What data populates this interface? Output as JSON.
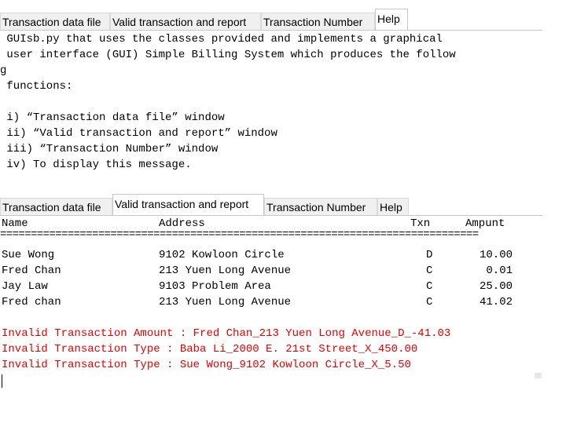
{
  "tabs": [
    "Transaction data file",
    "Valid transaction and report",
    "Transaction Number",
    "Help"
  ],
  "help": {
    "lines": [
      " GUIsb.py that uses the classes provided and implements a graphical",
      " user interface (GUI) Simple Billing System which produces the follow",
      "g",
      " functions:",
      "",
      " i) “Transaction data file” window",
      " ii) “Valid transaction and report” window",
      " iii) “Transaction Number” window",
      " iv) To display this message."
    ]
  },
  "report": {
    "header": {
      "name": "Name",
      "address": "Address",
      "txn": "Txn",
      "amount": "Ampunt"
    },
    "separator": "==============================================================================",
    "rows": [
      {
        "name": "Sue Wong",
        "address": "9102 Kowloon Circle",
        "txn": "D",
        "amount": "10.00"
      },
      {
        "name": "Fred Chan",
        "address": "213 Yuen Long Avenue",
        "txn": "C",
        "amount": "0.01"
      },
      {
        "name": "Jay Law",
        "address": "9103 Problem Area",
        "txn": "C",
        "amount": "25.00"
      },
      {
        "name": "Fred chan",
        "address": "213 Yuen Long Avenue",
        "txn": "C",
        "amount": "41.02"
      }
    ],
    "errors": [
      "Invalid Transaction Amount : Fred Chan_213 Yuen Long Avenue_D_-41.03",
      "Invalid Transaction Type : Baba Li_2000 E. 21st Street_X_450.00",
      "Invalid Transaction Type : Sue Wong_9102 Kowloon Circle_X_5.50"
    ]
  },
  "colors": {
    "error_text": "#e60000",
    "tab_inactive": "#f0f0f0"
  }
}
